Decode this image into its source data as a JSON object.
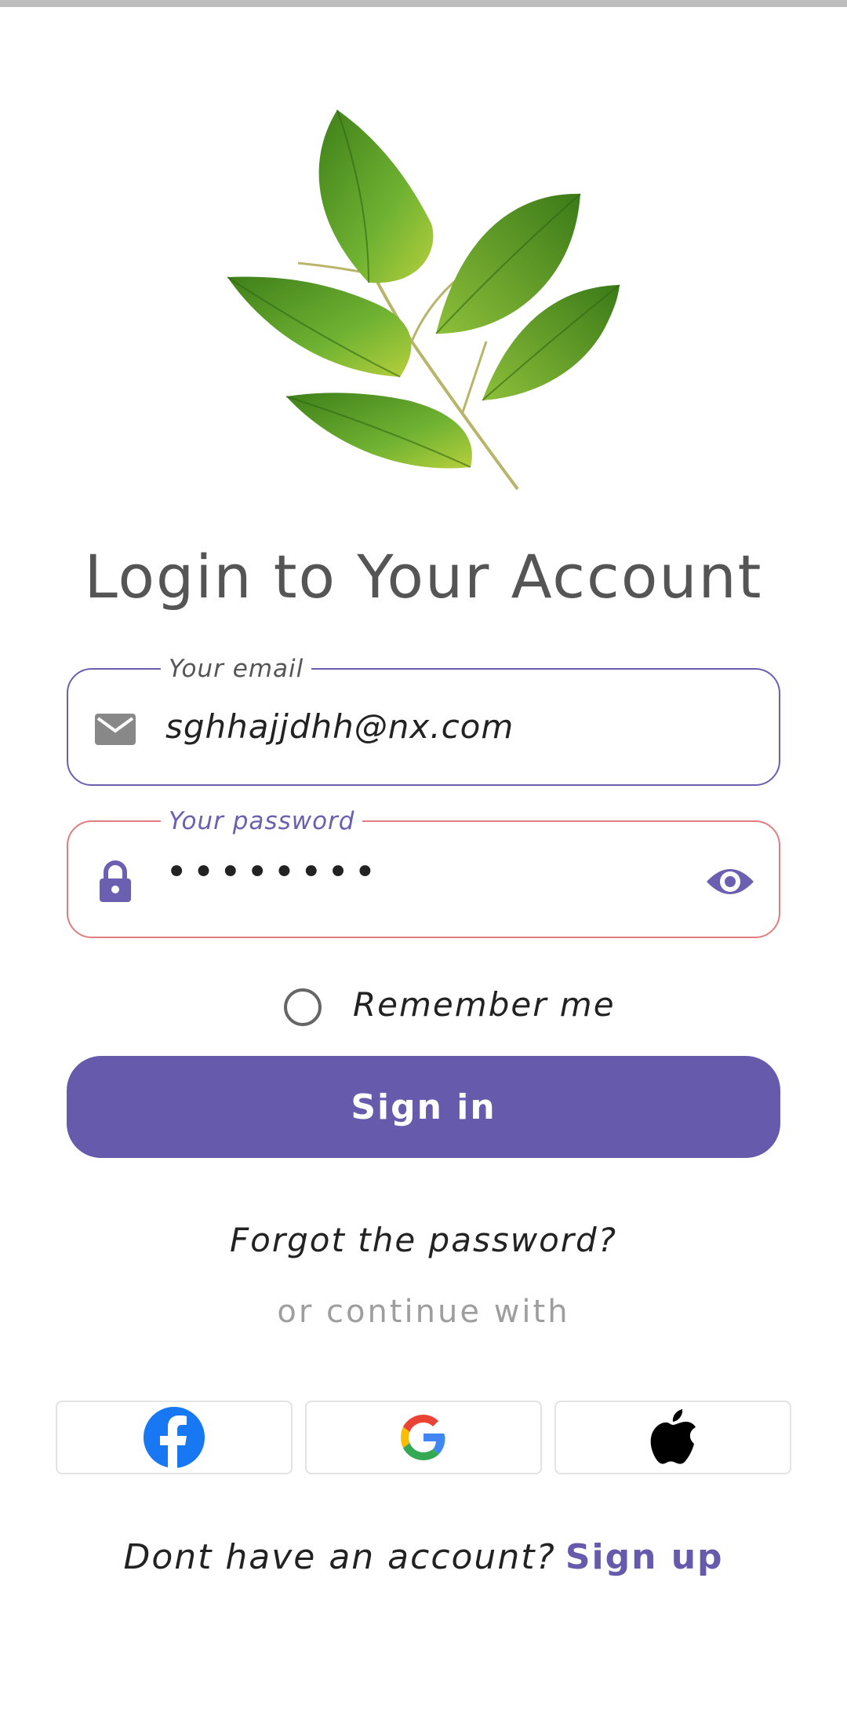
{
  "title": "Login to Your Account",
  "email": {
    "legend": "Your email",
    "value": "sghhajjdhh@nx.com"
  },
  "password": {
    "legend": "Your password",
    "value": "••••••••"
  },
  "remember": {
    "label": "Remember me",
    "checked": false
  },
  "signin": {
    "label": "Sign in"
  },
  "forgot": {
    "label": "Forgot the password?"
  },
  "continue": {
    "label": "or continue with"
  },
  "social": [
    "facebook-icon",
    "google-icon",
    "apple-icon"
  ],
  "signup": {
    "question": "Dont have an account?",
    "link": "Sign up"
  },
  "colors": {
    "accent": "#655aab",
    "error_border": "#e27d7d",
    "leaf": "#5a9e2a"
  }
}
